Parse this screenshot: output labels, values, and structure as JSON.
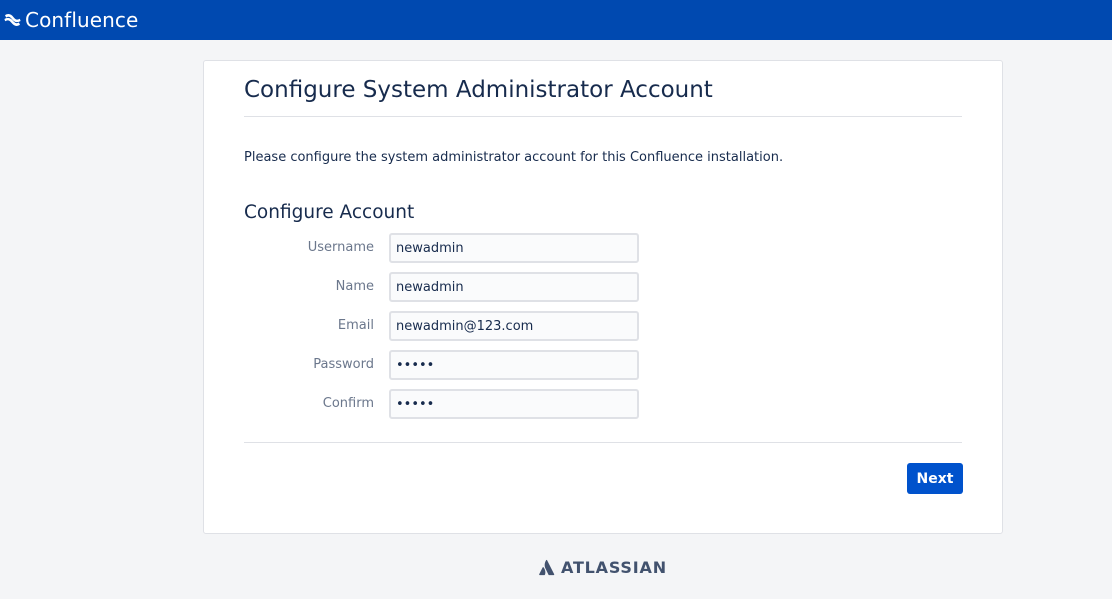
{
  "app": {
    "name": "Confluence"
  },
  "page": {
    "title": "Configure System Administrator Account",
    "intro": "Please configure the system administrator account for this Confluence installation.",
    "section_title": "Configure Account"
  },
  "form": {
    "fields": [
      {
        "label": "Username",
        "value": "newadmin",
        "type": "text"
      },
      {
        "label": "Name",
        "value": "newadmin",
        "type": "text"
      },
      {
        "label": "Email",
        "value": "newadmin@123.com",
        "type": "text"
      },
      {
        "label": "Password",
        "value": "•••••",
        "type": "password"
      },
      {
        "label": "Confirm",
        "value": "•••••",
        "type": "password"
      }
    ],
    "next_label": "Next"
  },
  "footer": {
    "brand": "ATLASSIAN"
  },
  "icons": {
    "app_logo": "confluence-logo-icon",
    "footer_logo": "atlassian-logo-icon"
  },
  "colors": {
    "header_bg": "#0049b0",
    "primary_button": "#0052cc",
    "page_bg": "#f4f5f7",
    "text": "#172b4d",
    "label": "#6b778c"
  }
}
